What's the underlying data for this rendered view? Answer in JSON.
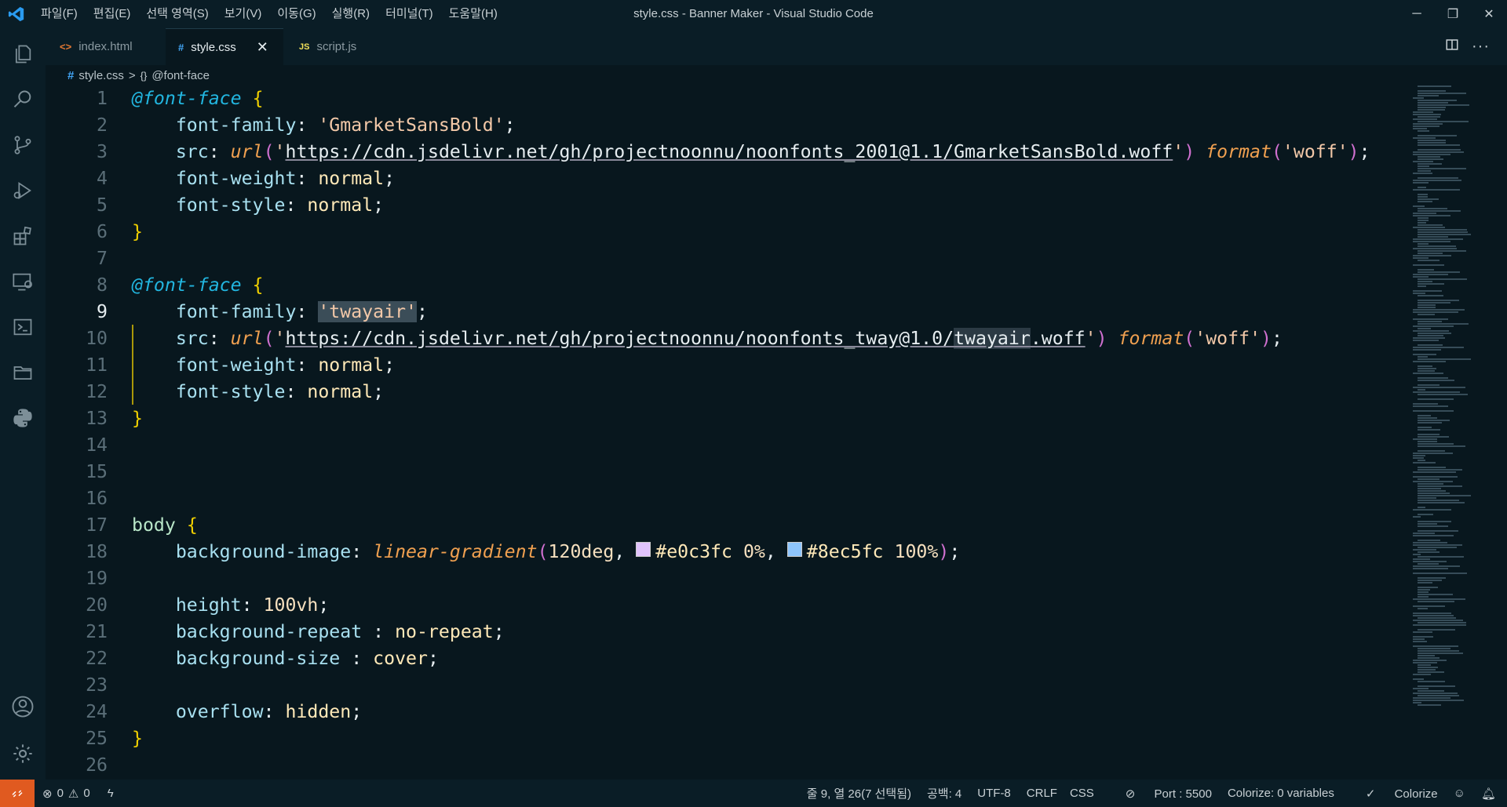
{
  "window": {
    "title": "style.css - Banner Maker - Visual Studio Code",
    "menu": [
      "파일(F)",
      "편집(E)",
      "선택 영역(S)",
      "보기(V)",
      "이동(G)",
      "실행(R)",
      "터미널(T)",
      "도움말(H)"
    ],
    "controls": {
      "minimize": "─",
      "restore": "❐",
      "close": "✕"
    }
  },
  "tabs": [
    {
      "icon": "<>",
      "label": "index.html",
      "icon_color": "#e37933"
    },
    {
      "icon": "#",
      "label": "style.css",
      "icon_color": "#42a5f5",
      "close": "✕"
    },
    {
      "icon": "JS",
      "label": "script.js",
      "icon_color": "#f1e05a"
    }
  ],
  "breadcrumb": {
    "file_icon": "#",
    "file": "style.css",
    "sep": ">",
    "symbol": "@font-face"
  },
  "editor": {
    "current_line": 9,
    "line_numbers": [
      "1",
      "2",
      "3",
      "4",
      "5",
      "6",
      "7",
      "8",
      "9",
      "10",
      "11",
      "12",
      "13",
      "14",
      "15",
      "16",
      "17",
      "18",
      "19",
      "20",
      "21",
      "22",
      "23",
      "24",
      "25",
      "26"
    ],
    "colors": {
      "swatch1": "#e0c3fc",
      "swatch2": "#8ec5fc"
    }
  },
  "statusbar": {
    "errors": "0",
    "warnings": "0",
    "position": "줄 9, 열 26(7 선택됨)",
    "spaces": "공백: 4",
    "encoding": "UTF-8",
    "eol": "CRLF",
    "language": "CSS",
    "port": "Port : 5500",
    "colorize_vars": "Colorize: 0 variables",
    "colorize": "Colorize"
  }
}
